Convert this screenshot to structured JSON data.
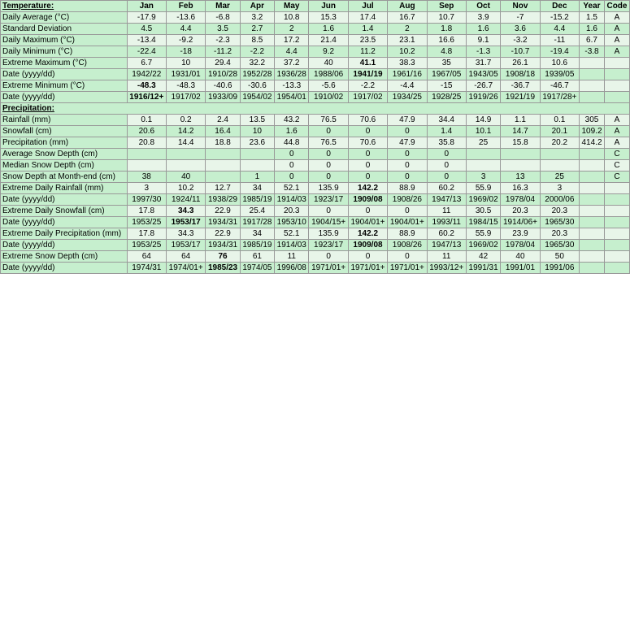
{
  "headers": {
    "row_header": "Temperature:",
    "cols": [
      "Jan",
      "Feb",
      "Mar",
      "Apr",
      "May",
      "Jun",
      "Jul",
      "Aug",
      "Sep",
      "Oct",
      "Nov",
      "Dec",
      "Year",
      "Code"
    ]
  },
  "rows": [
    {
      "label": "Daily Average (°C)",
      "values": [
        "-17.9",
        "-13.6",
        "-6.8",
        "3.2",
        "10.8",
        "15.3",
        "17.4",
        "16.7",
        "10.7",
        "3.9",
        "-7",
        "-15.2",
        "1.5",
        "A"
      ],
      "bold_indices": []
    },
    {
      "label": "Standard Deviation",
      "values": [
        "4.5",
        "4.4",
        "3.5",
        "2.7",
        "2",
        "1.6",
        "1.4",
        "2",
        "1.8",
        "1.6",
        "3.6",
        "4.4",
        "1.6",
        "A"
      ],
      "bold_indices": []
    },
    {
      "label": "Daily Maximum (°C)",
      "values": [
        "-13.4",
        "-9.2",
        "-2.3",
        "8.5",
        "17.2",
        "21.4",
        "23.5",
        "23.1",
        "16.6",
        "9.1",
        "-3.2",
        "-11",
        "6.7",
        "A"
      ],
      "bold_indices": []
    },
    {
      "label": "Daily Minimum (°C)",
      "values": [
        "-22.4",
        "-18",
        "-11.2",
        "-2.2",
        "4.4",
        "9.2",
        "11.2",
        "10.2",
        "4.8",
        "-1.3",
        "-10.7",
        "-19.4",
        "-3.8",
        "A"
      ],
      "bold_indices": []
    },
    {
      "label": "Extreme Maximum (°C)",
      "values": [
        "6.7",
        "10",
        "29.4",
        "32.2",
        "37.2",
        "40",
        "41.1",
        "38.3",
        "35",
        "31.7",
        "26.1",
        "10.6",
        "",
        ""
      ],
      "bold_indices": [
        6
      ]
    },
    {
      "label": "Date (yyyy/dd)",
      "values": [
        "1942/22",
        "1931/01",
        "1910/28",
        "1952/28",
        "1936/28",
        "1988/06",
        "1941/19",
        "1961/16",
        "1967/05",
        "1943/05",
        "1908/18",
        "1939/05",
        "",
        ""
      ],
      "bold_indices": [
        6
      ]
    },
    {
      "label": "Extreme Minimum (°C)",
      "values": [
        "-48.3",
        "-48.3",
        "-40.6",
        "-30.6",
        "-13.3",
        "-5.6",
        "-2.2",
        "-4.4",
        "-15",
        "-26.7",
        "-36.7",
        "-46.7",
        "",
        ""
      ],
      "bold_indices": [
        0
      ]
    },
    {
      "label": "Date (yyyy/dd)",
      "values": [
        "1916/12+",
        "1917/02",
        "1933/09",
        "1954/02",
        "1954/01",
        "1910/02",
        "1917/02",
        "1934/25",
        "1928/25",
        "1919/26",
        "1921/19",
        "1917/28+",
        "",
        ""
      ],
      "bold_indices": [
        0
      ]
    }
  ],
  "precipitation_label": "Precipitation:",
  "precip_rows": [
    {
      "label": "Rainfall (mm)",
      "values": [
        "0.1",
        "0.2",
        "2.4",
        "13.5",
        "43.2",
        "76.5",
        "70.6",
        "47.9",
        "34.4",
        "14.9",
        "1.1",
        "0.1",
        "305",
        "A"
      ],
      "bold_indices": []
    },
    {
      "label": "Snowfall (cm)",
      "values": [
        "20.6",
        "14.2",
        "16.4",
        "10",
        "1.6",
        "0",
        "0",
        "0",
        "1.4",
        "10.1",
        "14.7",
        "20.1",
        "109.2",
        "A"
      ],
      "bold_indices": []
    },
    {
      "label": "Precipitation (mm)",
      "values": [
        "20.8",
        "14.4",
        "18.8",
        "23.6",
        "44.8",
        "76.5",
        "70.6",
        "47.9",
        "35.8",
        "25",
        "15.8",
        "20.2",
        "414.2",
        "A"
      ],
      "bold_indices": []
    },
    {
      "label": "Average Snow Depth (cm)",
      "values": [
        "",
        "",
        "",
        "",
        "0",
        "0",
        "0",
        "0",
        "0",
        "",
        "",
        "",
        "",
        "C"
      ],
      "bold_indices": []
    },
    {
      "label": "Median Snow Depth (cm)",
      "values": [
        "",
        "",
        "",
        "",
        "0",
        "0",
        "0",
        "0",
        "0",
        "",
        "",
        "",
        "",
        "C"
      ],
      "bold_indices": []
    },
    {
      "label": "Snow Depth at Month-end (cm)",
      "values": [
        "38",
        "40",
        "",
        "1",
        "0",
        "0",
        "0",
        "0",
        "0",
        "3",
        "13",
        "25",
        "",
        "C"
      ],
      "bold_indices": []
    }
  ],
  "extreme_rows": [
    {
      "label": "Extreme Daily Rainfall (mm)",
      "values": [
        "3",
        "10.2",
        "12.7",
        "34",
        "52.1",
        "135.9",
        "142.2",
        "88.9",
        "60.2",
        "55.9",
        "16.3",
        "3",
        "",
        ""
      ],
      "bold_indices": [
        6
      ]
    },
    {
      "label": "Date (yyyy/dd)",
      "values": [
        "1997/30",
        "1924/11",
        "1938/29",
        "1985/19",
        "1914/03",
        "1923/17",
        "1909/08",
        "1908/26",
        "1947/13",
        "1969/02",
        "1978/04",
        "2000/06",
        "",
        ""
      ],
      "bold_indices": [
        6
      ]
    },
    {
      "label": "Extreme Daily Snowfall (cm)",
      "values": [
        "17.8",
        "34.3",
        "22.9",
        "25.4",
        "20.3",
        "0",
        "0",
        "0",
        "11",
        "30.5",
        "20.3",
        "20.3",
        "",
        ""
      ],
      "bold_indices": [
        1
      ]
    },
    {
      "label": "Date (yyyy/dd)",
      "values": [
        "1953/25",
        "1953/17",
        "1934/31",
        "1917/28",
        "1953/10",
        "1904/15+",
        "1904/01+",
        "1904/01+",
        "1993/11",
        "1984/15",
        "1914/06+",
        "1965/30",
        "",
        ""
      ],
      "bold_indices": [
        1
      ]
    },
    {
      "label": "Extreme Daily Precipitation (mm)",
      "values": [
        "17.8",
        "34.3",
        "22.9",
        "34",
        "52.1",
        "135.9",
        "142.2",
        "88.9",
        "60.2",
        "55.9",
        "23.9",
        "20.3",
        "",
        ""
      ],
      "bold_indices": [
        6
      ]
    },
    {
      "label": "Date (yyyy/dd)",
      "values": [
        "1953/25",
        "1953/17",
        "1934/31",
        "1985/19",
        "1914/03",
        "1923/17",
        "1909/08",
        "1908/26",
        "1947/13",
        "1969/02",
        "1978/04",
        "1965/30",
        "",
        ""
      ],
      "bold_indices": [
        6
      ]
    },
    {
      "label": "Extreme Snow Depth (cm)",
      "values": [
        "64",
        "64",
        "76",
        "61",
        "11",
        "0",
        "0",
        "0",
        "11",
        "42",
        "40",
        "50",
        "",
        ""
      ],
      "bold_indices": [
        2
      ]
    },
    {
      "label": "Date (yyyy/dd)",
      "values": [
        "1974/31",
        "1974/01+",
        "1985/23",
        "1974/05",
        "1996/08",
        "1971/01+",
        "1971/01+",
        "1971/01+",
        "1993/12+",
        "1991/31",
        "1991/01",
        "1991/06",
        "",
        ""
      ],
      "bold_indices": [
        2
      ]
    }
  ]
}
